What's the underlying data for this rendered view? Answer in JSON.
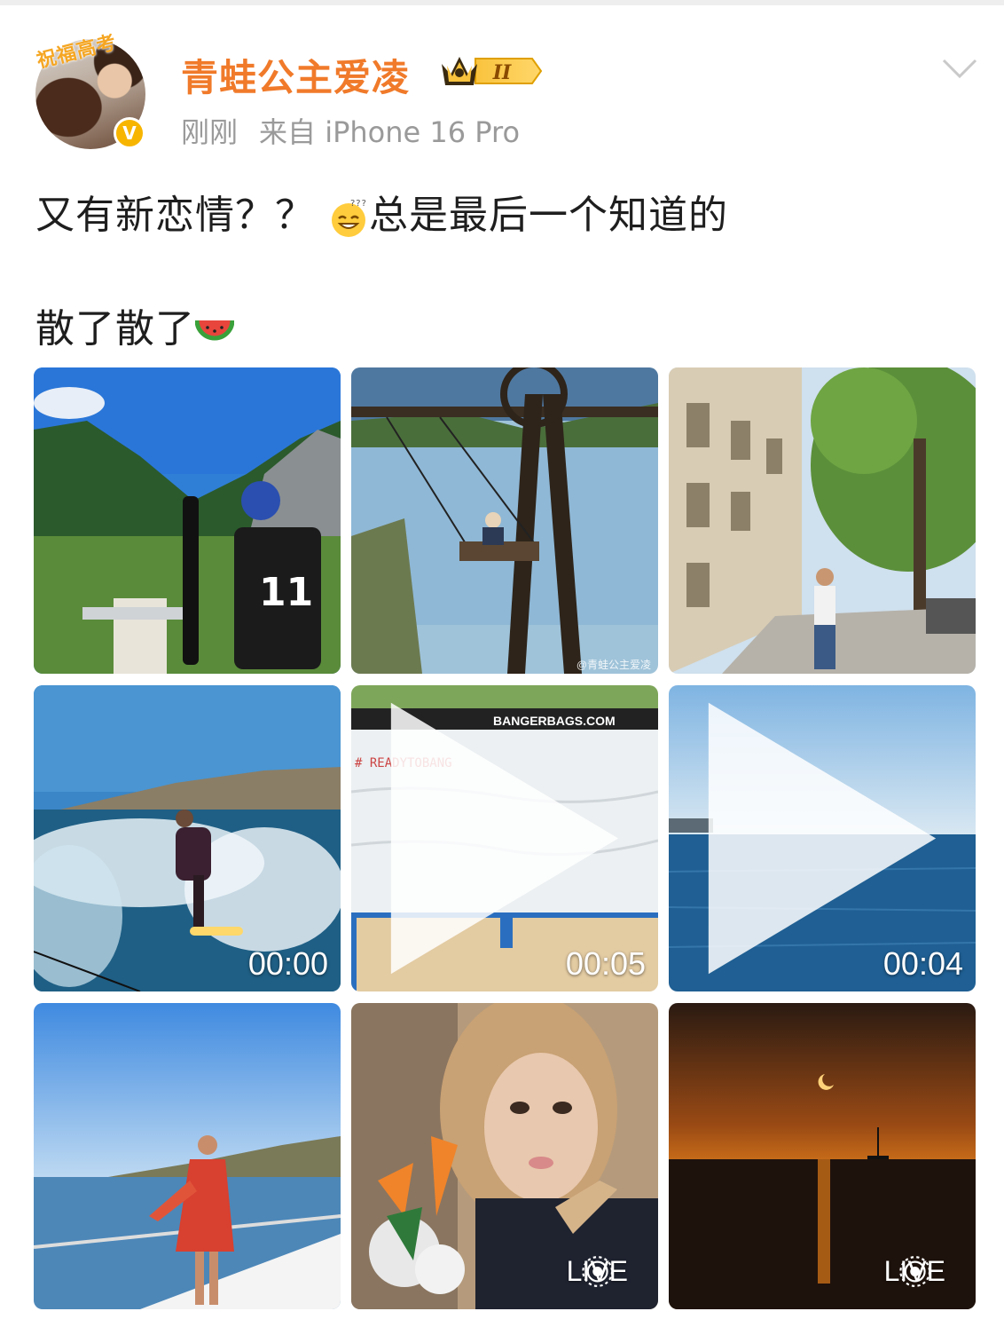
{
  "post": {
    "username": "青蛙公主爱凌",
    "level_badge": "II",
    "avatar_banner": "祝福高考",
    "verified_mark": "V",
    "time": "刚刚",
    "source": "来自 iPhone 16 Pro",
    "text_line1_a": "又有新恋情？？",
    "text_line1_b": "总是最后一个知道的",
    "text_line2": "散了散了",
    "emoji1": "sweat-smile-emoji",
    "emoji2": "watermelon-emoji"
  },
  "media": [
    {
      "kind": "photo",
      "desc": "ski-jump-mountain"
    },
    {
      "kind": "photo",
      "desc": "lake-swing",
      "watermark": "@青蛙公主爱凌"
    },
    {
      "kind": "photo",
      "desc": "paris-street"
    },
    {
      "kind": "video",
      "desc": "wake-surfing",
      "duration": "00:00"
    },
    {
      "kind": "video",
      "desc": "airbag-landing",
      "duration": "00:05",
      "text_sign": "BANGERBAGS.COM",
      "text_banner": "# READYTOBANG"
    },
    {
      "kind": "video",
      "desc": "open-sea",
      "duration": "00:04"
    },
    {
      "kind": "photo",
      "desc": "yacht-deck"
    },
    {
      "kind": "live",
      "desc": "selfie-flowers",
      "live_label": "LIVE"
    },
    {
      "kind": "live",
      "desc": "sunset-sea",
      "live_label": "LIVE"
    }
  ],
  "colors": {
    "username": "#f07a2a",
    "meta": "#9a9a9a",
    "verified": "#f7b500",
    "text": "#1e1e1e"
  }
}
